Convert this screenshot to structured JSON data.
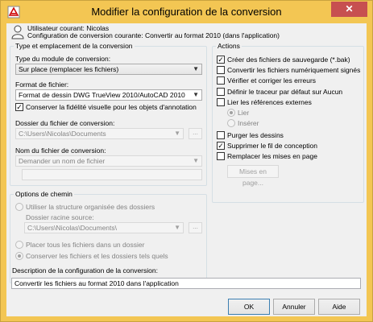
{
  "window": {
    "title": "Modifier la configuration de la conversion",
    "close_glyph": "✕"
  },
  "header": {
    "user_line": "Utilisateur courant: Nicolas",
    "config_line": "Configuration de conversion courante: Convertir au format 2010 (dans l'application)"
  },
  "left_group": {
    "title": "Type et emplacement de la conversion",
    "package_type_label": "Type du module de conversion:",
    "package_type_value": "Sur place (remplacer les fichiers)",
    "file_format_label": "Format de fichier:",
    "file_format_value": "Format de dessin DWG TrueView 2010/AutoCAD 2010",
    "keep_visual_fidelity": {
      "label": "Conserver la fidélité visuelle pour les objets d'annotation",
      "checked": true
    },
    "folder_label": "Dossier du fichier de conversion:",
    "folder_value": "C:\\Users\\Nicolas\\Documents",
    "browse_label": "...",
    "filename_label": "Nom du fichier de conversion:",
    "filename_value": "Demander un nom de fichier",
    "filename_text_value": ""
  },
  "path_group": {
    "title": "Options de chemin",
    "use_org_structure": "Utiliser la structure organisée des dossiers",
    "root_folder_label": "Dossier racine source:",
    "root_folder_value": "C:\\Users\\Nicolas\\Documents\\",
    "browse_label": "...",
    "place_all_files": "Placer tous les fichiers dans un dossier",
    "keep_files_folders": "Conserver les fichiers et les dossiers tels quels"
  },
  "actions": {
    "title": "Actions",
    "items": [
      {
        "label": "Créer des fichiers de sauvegarde (*.bak)",
        "checked": true
      },
      {
        "label": "Convertir les fichiers numériquement signés",
        "checked": false
      },
      {
        "label": "Vérifier et corriger les erreurs",
        "checked": false
      },
      {
        "label": "Définir le traceur par défaut sur Aucun",
        "checked": false
      },
      {
        "label": "Lier les références externes",
        "checked": false
      },
      {
        "label": "Purger les dessins",
        "checked": false
      },
      {
        "label": "Supprimer le fil de conception",
        "checked": true
      },
      {
        "label": "Remplacer les mises en page",
        "checked": false
      }
    ],
    "xref_bind": "Lier",
    "xref_insert": "Insérer",
    "page_setups_button": "Mises en page..."
  },
  "description": {
    "label": "Description de la configuration de la conversion:",
    "value": "Convertir les fichiers au format 2010 dans l'application"
  },
  "buttons": {
    "ok": "OK",
    "cancel": "Annuler",
    "help": "Aide"
  },
  "colors": {
    "titlebar": "#f3c653",
    "close": "#c75050",
    "client": "#f0f0f0"
  }
}
